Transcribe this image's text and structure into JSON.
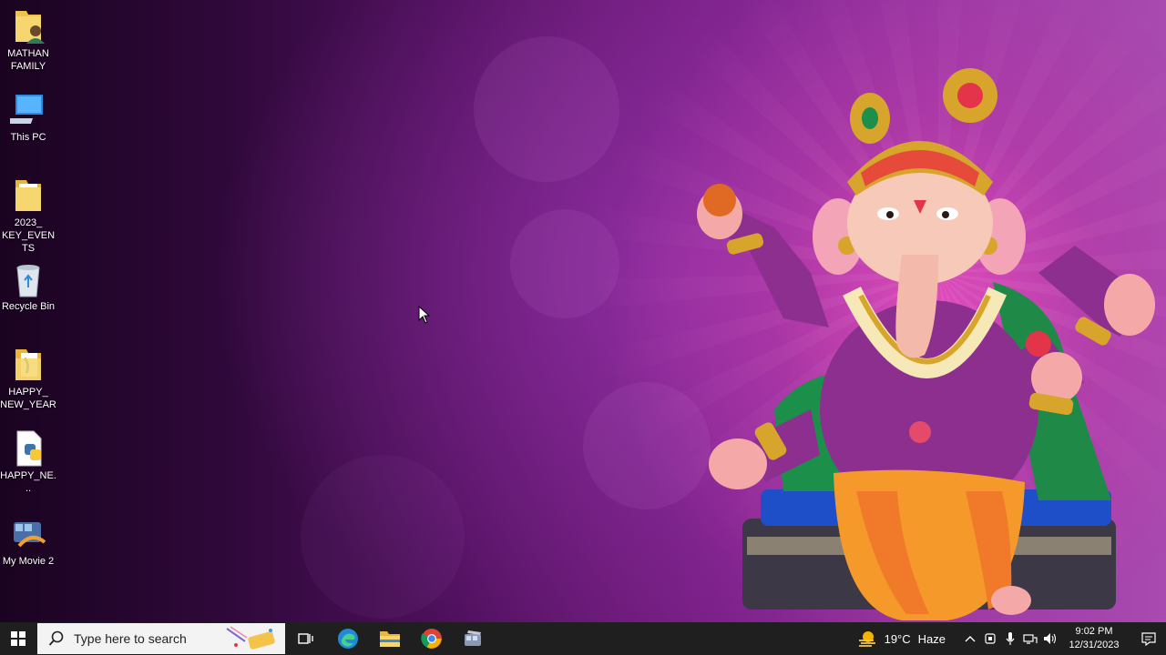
{
  "desktop": {
    "icons": [
      {
        "label": "MATHAN\nFAMILY",
        "icon": "user-folder-icon"
      },
      {
        "label": "This PC",
        "icon": "computer-icon"
      },
      {
        "label": "2023_\nKEY_EVENTS",
        "icon": "folder-icon"
      },
      {
        "label": "Recycle Bin",
        "icon": "recycle-bin-icon"
      },
      {
        "label": "HAPPY_\nNEW_YEAR",
        "icon": "folder-icon"
      },
      {
        "label": "HAPPY_NE...",
        "icon": "python-file-icon"
      },
      {
        "label": "My Movie 2",
        "icon": "movie-maker-icon"
      }
    ]
  },
  "taskbar": {
    "search_placeholder": "Type here to search",
    "pinned": [
      "task-view",
      "edge",
      "file-explorer",
      "chrome",
      "movie-maker"
    ],
    "weather": {
      "temperature": "19°C",
      "condition": "Haze"
    },
    "clock": {
      "time": "9:02 PM",
      "date": "12/31/2023"
    }
  },
  "colors": {
    "taskbar": "#1f1f1f",
    "search_bg": "#f3f3f3",
    "wallpaper_accent": "#a84ab0"
  }
}
